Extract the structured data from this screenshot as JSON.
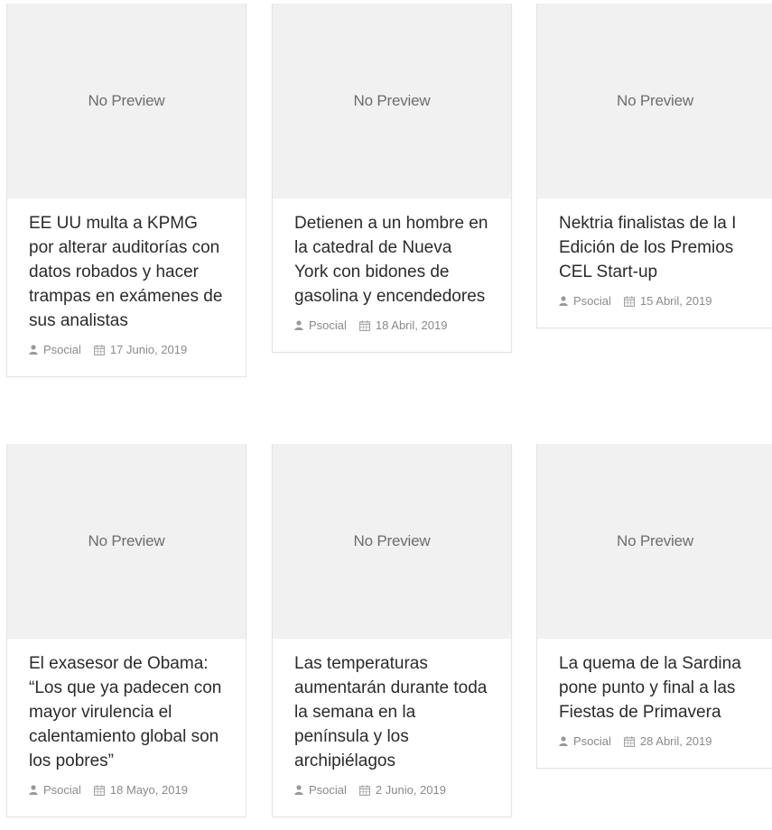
{
  "preview_text": "No Preview",
  "posts": [
    {
      "title": "EE UU multa a KPMG por alterar auditorías con datos robados y hacer trampas en exámenes de sus analistas",
      "author": "Psocial",
      "date": "17 Junio, 2019"
    },
    {
      "title": "Detienen a un hombre en la catedral de Nueva York con bidones de gasolina y encendedores",
      "author": "Psocial",
      "date": "18 Abril, 2019"
    },
    {
      "title": "Nektria finalistas de la I Edición de los Premios CEL Start-up",
      "author": "Psocial",
      "date": "15 Abril, 2019"
    },
    {
      "title": "El exasesor de Obama: “Los que ya padecen con mayor virulencia el calentamiento global son los pobres”",
      "author": "Psocial",
      "date": "18 Mayo, 2019"
    },
    {
      "title": "Las temperaturas aumentarán durante toda la semana en la península y los archipiélagos",
      "author": "Psocial",
      "date": "2 Junio, 2019"
    },
    {
      "title": "La quema de la Sardina pone punto y final a las Fiestas de Primavera",
      "author": "Psocial",
      "date": "28 Abril, 2019"
    }
  ],
  "icons": {
    "author": "user-icon",
    "date": "calendar-icon"
  },
  "colors": {
    "thumb_bg": "#f1f1f1",
    "meta_text": "#8a8a8a",
    "title_text": "#2b2b2b",
    "border": "#e4e4e4"
  }
}
